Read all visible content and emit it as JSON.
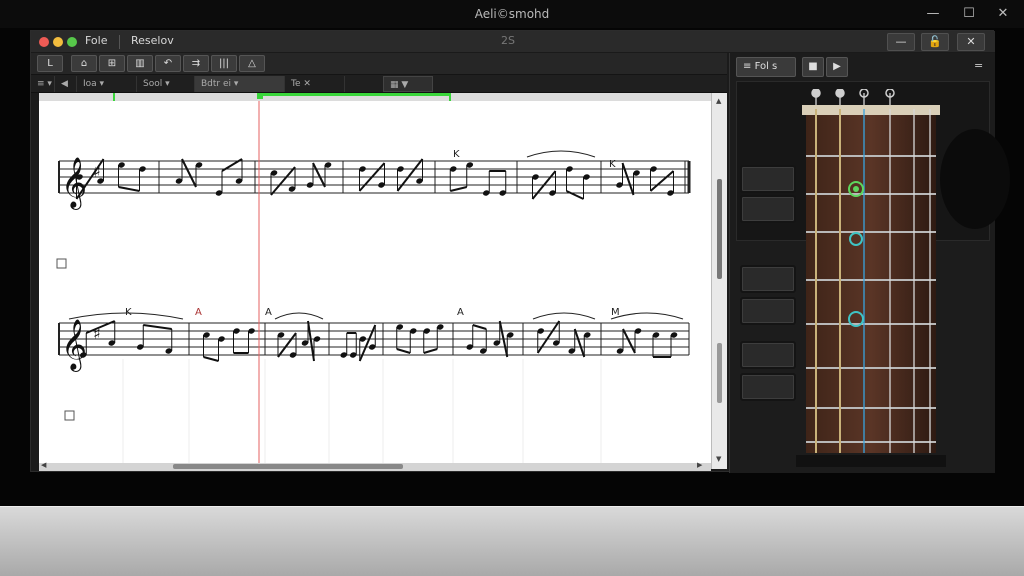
{
  "os_window": {
    "title": "Aeli©smohd",
    "min_glyph": "—",
    "max_glyph": "☐",
    "close_glyph": "✕"
  },
  "app": {
    "menu": [
      "Fole",
      "Reselov"
    ],
    "center_label": "2S",
    "header_buttons": [
      "—",
      "🔓",
      "✕"
    ],
    "toolbar_buttons": [
      "L",
      "⌂",
      "⊞",
      "▥",
      "↶",
      "⇉",
      "|||",
      "△"
    ],
    "subtoolbar_fields": [
      {
        "label": "≡ ▾",
        "width": 24
      },
      {
        "label": "◀",
        "width": 22
      },
      {
        "label": "Ioa  ▾",
        "width": 60
      },
      {
        "label": "Sool  ▾",
        "width": 58
      },
      {
        "label": "Bdtr ei ▾",
        "width": 90
      },
      {
        "label": "Te  ✕",
        "width": 60
      }
    ],
    "subtoolbar_right": "▦  ▼"
  },
  "score": {
    "system1_marks": [
      "K",
      "K"
    ],
    "system2_marks": [
      "K",
      "A",
      "A",
      "A",
      "M"
    ],
    "playhead": "playhead"
  },
  "panel": {
    "mode_label": "Fol s",
    "eq_glyph": "≡",
    "stop_glyph": "■",
    "play_glyph": "▶",
    "menu_glyph": "="
  },
  "colors": {
    "accent_green": "#39d63a",
    "playhead_red": "#e46060",
    "finger_green": "#5dd65d",
    "finger_teal": "#3fc4c4",
    "string_blue": "#37a3e0"
  }
}
